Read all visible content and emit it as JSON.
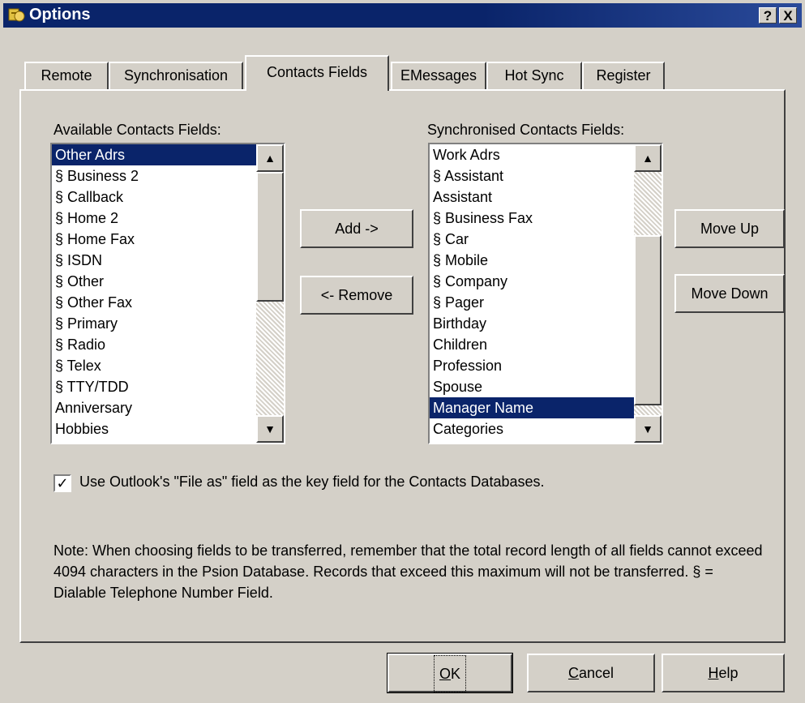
{
  "window": {
    "title": "Options",
    "help_btn": "?",
    "close_btn": "X"
  },
  "tabs": [
    {
      "label": "Remote"
    },
    {
      "label": "Synchronisation"
    },
    {
      "label": "Contacts Fields",
      "active": true
    },
    {
      "label": "EMessages"
    },
    {
      "label": "Hot Sync"
    },
    {
      "label": "Register"
    }
  ],
  "available": {
    "label": "Available Contacts Fields:",
    "items": [
      "Other Adrs",
      "§ Business 2",
      "§ Callback",
      "§ Home 2",
      "§ Home Fax",
      "§ ISDN",
      "§ Other",
      "§ Other Fax",
      "§ Primary",
      "§ Radio",
      "§ Telex",
      "§ TTY/TDD",
      "Anniversary",
      "Hobbies"
    ],
    "selected_index": 0
  },
  "synced": {
    "label": "Synchronised Contacts Fields:",
    "items": [
      "Work Adrs",
      "§ Assistant",
      "Assistant",
      "§ Business Fax",
      "§ Car",
      "§ Mobile",
      "§ Company",
      "§ Pager",
      "Birthday",
      "Children",
      "Profession",
      "Spouse",
      "Manager Name",
      "Categories"
    ],
    "selected_index": 12
  },
  "buttons": {
    "add": "Add ->",
    "remove": "<- Remove",
    "move_up": "Move Up",
    "move_down": "Move Down",
    "ok": "OK",
    "cancel": "Cancel",
    "help": "Help"
  },
  "checkbox": {
    "checked": true,
    "label": "Use Outlook's \"File as\" field as the key field for the Contacts Databases."
  },
  "note": "Note: When choosing fields to be transferred, remember that the total record length of all fields cannot exceed 4094 characters in the Psion Database.  Records that exceed this maximum will not be transferred.  § = Dialable Telephone Number Field."
}
